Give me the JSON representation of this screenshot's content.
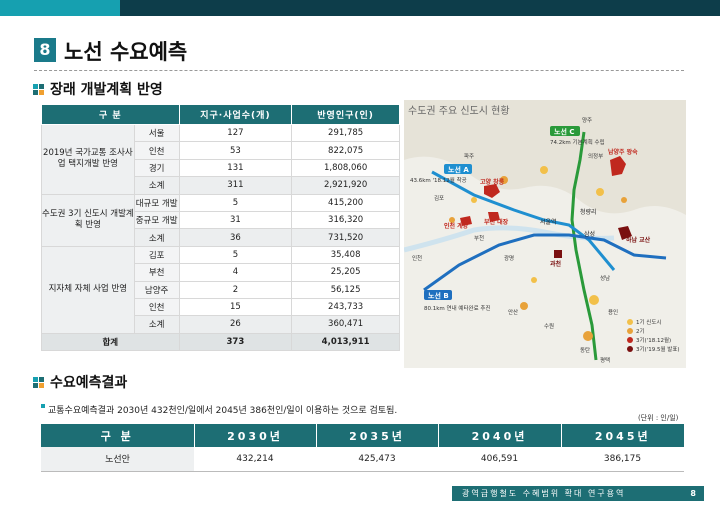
{
  "header": {
    "section_number": "8",
    "title": "노선 수요예측"
  },
  "section1": {
    "title": "장래 개발계획 반영",
    "table": {
      "headers": [
        "구 분",
        "지구·사업수(개)",
        "반영인구(인)"
      ],
      "groups": [
        {
          "name": "2019년 국가교통 조사사업 택지개발 반영",
          "rows": [
            {
              "sub": "서울",
              "count": "127",
              "pop": "291,785"
            },
            {
              "sub": "인천",
              "count": "53",
              "pop": "822,075"
            },
            {
              "sub": "경기",
              "count": "131",
              "pop": "1,808,060"
            },
            {
              "sub": "소계",
              "count": "311",
              "pop": "2,921,920"
            }
          ]
        },
        {
          "name": "수도권 3기 신도시 개발계획 반영",
          "rows": [
            {
              "sub": "대규모 개발",
              "count": "5",
              "pop": "415,200"
            },
            {
              "sub": "중규모 개발",
              "count": "31",
              "pop": "316,320"
            },
            {
              "sub": "소계",
              "count": "36",
              "pop": "731,520"
            }
          ]
        },
        {
          "name": "지자체 자체 사업 반영",
          "rows": [
            {
              "sub": "김포",
              "count": "5",
              "pop": "35,408"
            },
            {
              "sub": "부천",
              "count": "4",
              "pop": "25,205"
            },
            {
              "sub": "남양주",
              "count": "2",
              "pop": "56,125"
            },
            {
              "sub": "인천",
              "count": "15",
              "pop": "243,733"
            },
            {
              "sub": "소계",
              "count": "26",
              "pop": "360,471"
            }
          ]
        }
      ],
      "total": {
        "label": "합계",
        "count": "373",
        "pop": "4,013,911"
      }
    },
    "map": {
      "title": "수도권 주요 신도시 현황",
      "line_labels": {
        "a": "노선 A",
        "b": "노선 B",
        "c": "노선 C"
      },
      "notes": {
        "a": "43.6km '18.12월 착공",
        "b": "80.1km 연내 예타완료 추진",
        "c": "74.2km 기본계획 수립"
      },
      "cities": [
        "남양주 왕숙",
        "고양 창릉",
        "부천 대장",
        "인천 계양",
        "하남 교산",
        "과천",
        "서울역",
        "청량리",
        "삼성",
        "부천",
        "김포",
        "파주",
        "양주",
        "의정부",
        "수원",
        "안산",
        "성남",
        "광명",
        "용인",
        "평택",
        "동탄",
        "인천"
      ],
      "legend": [
        "1기 신도시",
        "2기",
        "3기('18.12월)",
        "3기('19.5월 발표)"
      ],
      "colors": {
        "line_a": "#1f8fd0",
        "line_b": "#1f6fbf",
        "line_c": "#2a9a3a",
        "gen1": "#f2c04a",
        "gen2": "#e8a23a",
        "gen3a": "#c0281e",
        "gen3b": "#7a1010"
      }
    }
  },
  "section2": {
    "title": "수요예측결과",
    "note": "교통수요예측결과 2030년 432천인/일에서 2045년 386천인/일이 이용하는 것으로 검토됨.",
    "unit": "(단위 : 인/일)",
    "table": {
      "headers": [
        "구 분",
        "2030년",
        "2035년",
        "2040년",
        "2045년"
      ],
      "rows": [
        {
          "label": "노선안",
          "values": [
            "432,214",
            "425,473",
            "406,591",
            "386,175"
          ]
        }
      ]
    }
  },
  "footer": {
    "text": "광역급행철도 수혜범위 확대 연구용역",
    "page": "8"
  }
}
